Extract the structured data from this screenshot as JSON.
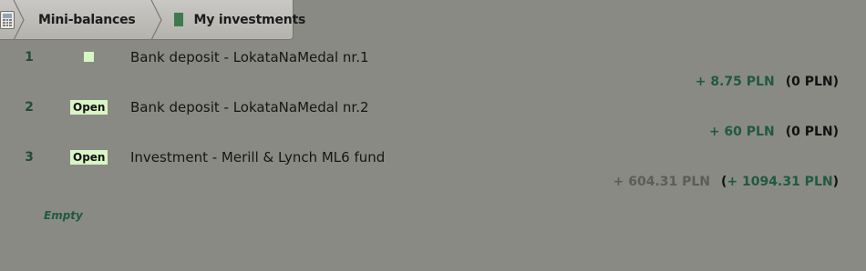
{
  "breadcrumb": {
    "home_icon": "calculator-icon",
    "items": [
      {
        "label": "Mini-balances"
      },
      {
        "label": "My investments",
        "icon": "document-icon"
      }
    ]
  },
  "investments": [
    {
      "number": "1",
      "status": "",
      "title": "Bank deposit - LokataNaMedal nr.1",
      "amount": "+ 8.75 PLN",
      "total": "(0 PLN)"
    },
    {
      "number": "2",
      "status": "Open",
      "title": "Bank deposit - LokataNaMedal nr.2",
      "amount": "+ 60 PLN",
      "total": "(0 PLN)"
    },
    {
      "number": "3",
      "status": "Open",
      "title": "Investment - Merill & Lynch ML6 fund",
      "amount": "+ 604.31 PLN",
      "total_prefix": "(",
      "total_value": "+ 1094.31 PLN",
      "total_suffix": ")"
    }
  ],
  "empty_label": "Empty",
  "colors": {
    "background": "#8a8a84",
    "accent_green": "#1f5a3f",
    "badge_bg": "#d7f5c5"
  }
}
